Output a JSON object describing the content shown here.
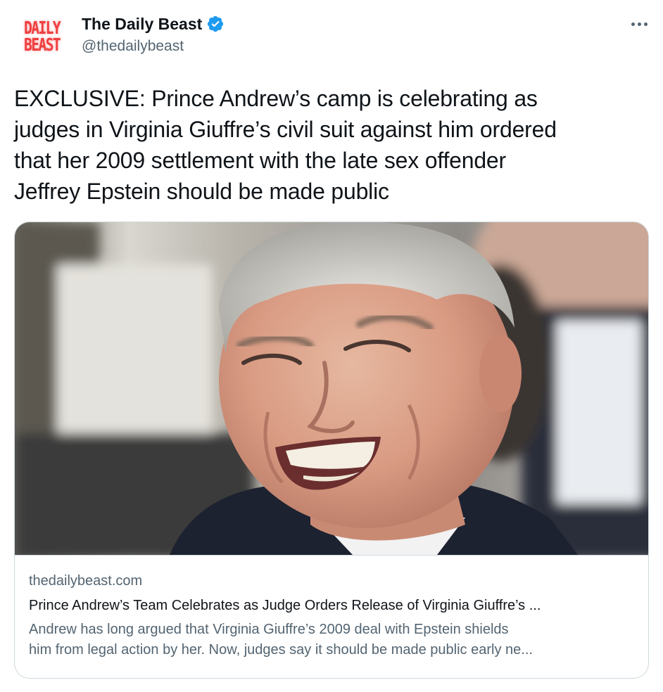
{
  "tweet": {
    "author": {
      "avatar_logo_lines": [
        "DAILY",
        "BEAST"
      ],
      "display_name": "The Daily Beast",
      "handle": "@thedailybeast",
      "verified": true,
      "verified_icon": "verified-badge-icon"
    },
    "more_icon": "more-options-icon",
    "text": "EXCLUSIVE: Prince Andrew’s camp is celebrating as\njudges in Virginia Giuffre’s civil suit against him ordered\nthat her 2009 settlement with the late sex offender\nJeffrey Epstein should be made public",
    "card": {
      "domain": "thedailybeast.com",
      "title": "Prince Andrew’s Team Celebrates as Judge Orders Release of Virginia Giuffre’s ...",
      "description_lines": [
        "Andrew has long argued that Virginia Giuffre’s 2009 deal with Epstein shields",
        "him from legal action by her. Now, judges say it should be made public early ne..."
      ]
    }
  },
  "colors": {
    "text_primary": "#0f1419",
    "text_secondary": "#536471",
    "verified_blue": "#1d9bf0",
    "border": "#cfd9de",
    "logo_red": "#ef3e3e"
  }
}
